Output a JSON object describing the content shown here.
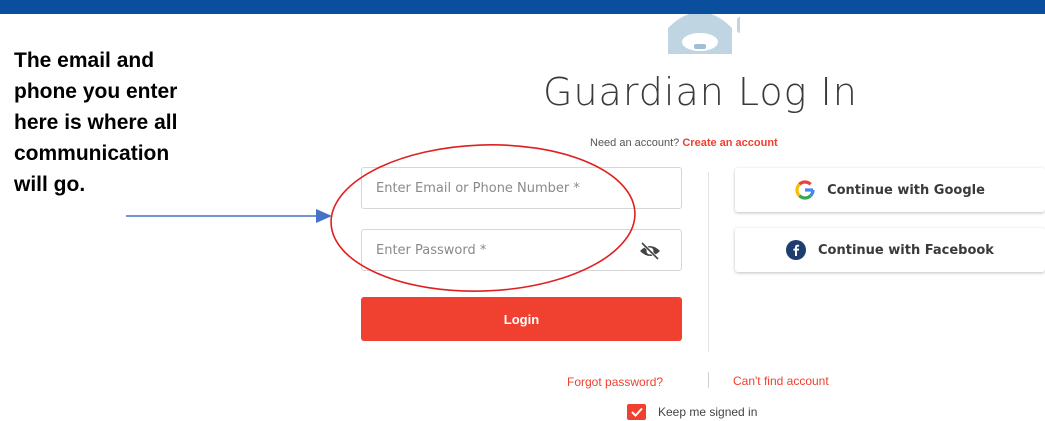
{
  "annotation": {
    "lines": [
      "The email and",
      "phone you enter",
      "here is where all",
      "communication",
      "will go."
    ]
  },
  "login": {
    "title": "Guardian Log In",
    "need_account_text": "Need an account?",
    "create_account_link": "Create an account",
    "email_placeholder": "Enter Email or Phone Number *",
    "password_placeholder": "Enter Password *",
    "login_button": "Login",
    "forgot_password": "Forgot password?",
    "cant_find_account": "Can't find account",
    "keep_signed_in": "Keep me signed in",
    "keep_signed_in_checked": true
  },
  "social": {
    "google_label": "Continue with Google",
    "facebook_label": "Continue with Facebook"
  },
  "icons": {
    "logo": "guardian-logo-icon",
    "eye": "eye-slash-icon",
    "google": "google-icon",
    "facebook": "facebook-icon",
    "check": "check-icon"
  },
  "colors": {
    "topbar": "#0a4f9e",
    "accent": "#f0402f",
    "facebook": "#1f3d6e",
    "annotation_circle": "#e02020",
    "arrow": "#4472c4"
  }
}
